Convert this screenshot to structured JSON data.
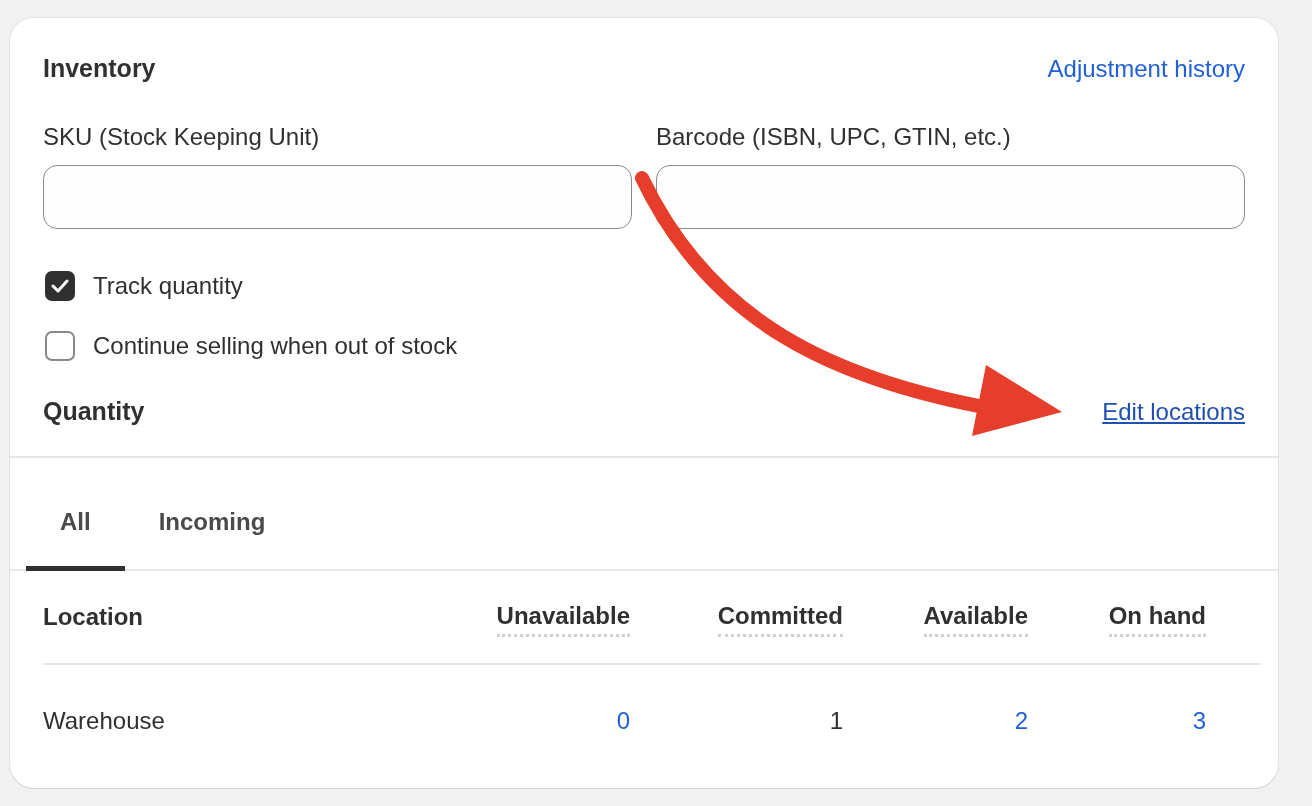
{
  "card": {
    "title": "Inventory",
    "history_link": "Adjustment history"
  },
  "fields": [
    {
      "label": "SKU (Stock Keeping Unit)"
    },
    {
      "label": "Barcode (ISBN, UPC, GTIN, etc.)"
    }
  ],
  "checkboxes": [
    {
      "label": "Track quantity",
      "checked": true
    },
    {
      "label": "Continue selling when out of stock",
      "checked": false
    }
  ],
  "quantity": {
    "title": "Quantity",
    "edit_link": "Edit locations"
  },
  "tabs": [
    {
      "label": "All",
      "selected": true
    },
    {
      "label": "Incoming",
      "selected": false
    }
  ],
  "table": {
    "columns": [
      "Location",
      "Unavailable",
      "Committed",
      "Available",
      "On hand"
    ],
    "rows": [
      {
        "cells": [
          {
            "text": "Warehouse",
            "kind": "text"
          },
          {
            "text": "0",
            "kind": "link"
          },
          {
            "text": "1",
            "kind": "text"
          },
          {
            "text": "2",
            "kind": "link"
          },
          {
            "text": "3",
            "kind": "link"
          }
        ]
      }
    ]
  }
}
